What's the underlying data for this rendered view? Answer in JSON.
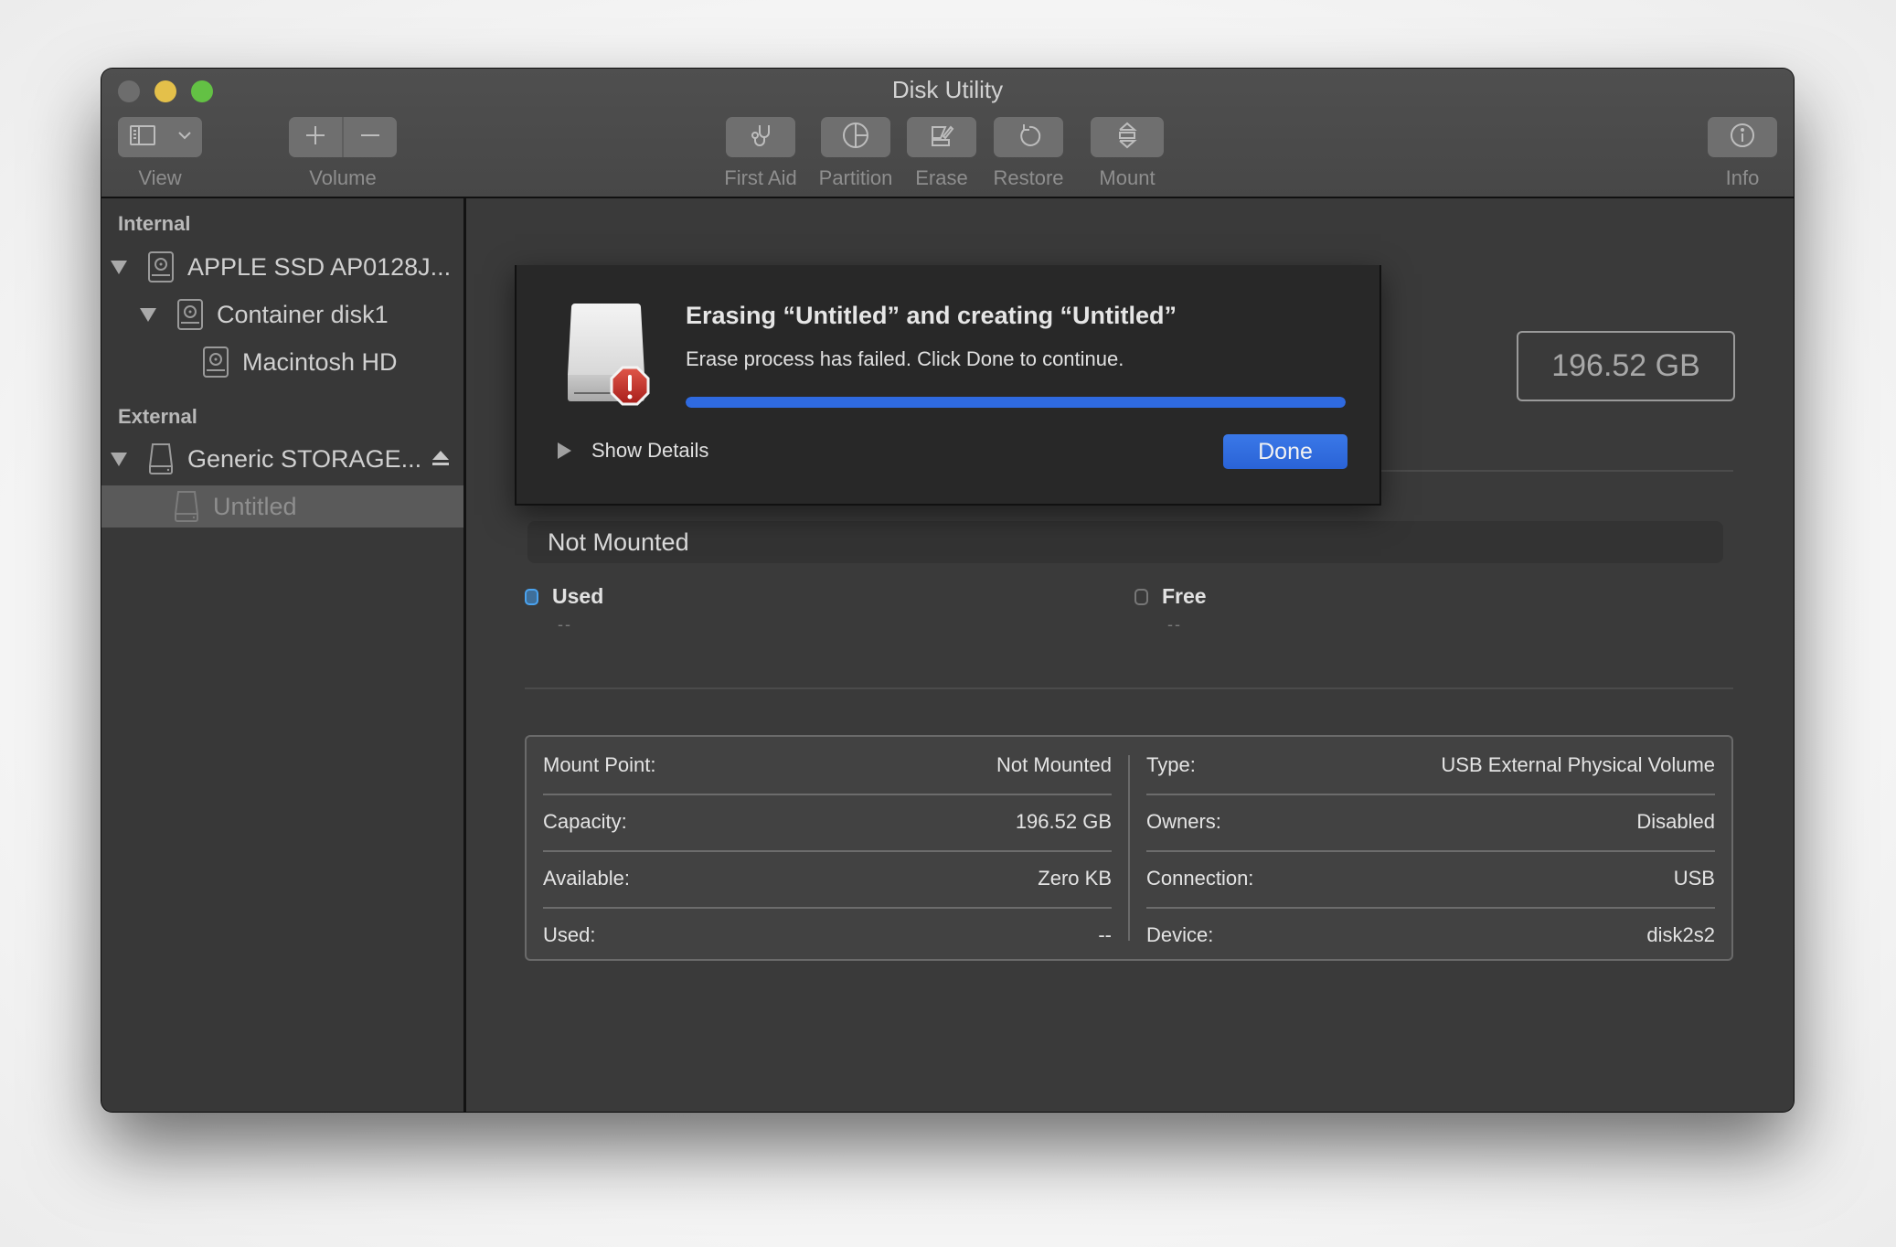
{
  "window": {
    "title": "Disk Utility",
    "traffic_lights": {
      "close": "#6d6d6d",
      "minimize": "#e4c04a",
      "maximize": "#63c144"
    }
  },
  "toolbar": {
    "view": {
      "label": "View",
      "icon": "sidebar-icon"
    },
    "volume": {
      "label": "Volume",
      "add_icon": "plus-icon",
      "remove_icon": "minus-icon"
    },
    "actions": [
      {
        "label": "First Aid",
        "icon": "stethoscope-icon"
      },
      {
        "label": "Partition",
        "icon": "pie-chart-icon"
      },
      {
        "label": "Erase",
        "icon": "erase-icon"
      },
      {
        "label": "Restore",
        "icon": "restore-icon"
      },
      {
        "label": "Mount",
        "icon": "mount-icon"
      }
    ],
    "info": {
      "label": "Info",
      "icon": "info-icon"
    }
  },
  "sidebar": {
    "sections": [
      {
        "title": "Internal",
        "items": [
          {
            "label": "APPLE SSD AP0128J...",
            "level": 0,
            "expanded": true,
            "icon": "internal-disk-icon"
          },
          {
            "label": "Container disk1",
            "level": 1,
            "expanded": true,
            "icon": "internal-disk-icon"
          },
          {
            "label": "Macintosh HD",
            "level": 2,
            "icon": "internal-disk-icon"
          }
        ]
      },
      {
        "title": "External",
        "items": [
          {
            "label": "Generic STORAGE...",
            "level": 0,
            "expanded": true,
            "icon": "external-disk-icon",
            "eject": true
          },
          {
            "label": "Untitled",
            "level": 1,
            "selected": true,
            "icon": "external-disk-icon"
          }
        ]
      }
    ]
  },
  "main": {
    "capacity_badge": "196.52 GB",
    "usage_bar_label": "Not Mounted",
    "legend": [
      {
        "label": "Used",
        "value": "--",
        "color": "#3b82c4"
      },
      {
        "label": "Free",
        "value": "--",
        "color": "#3a3a3a"
      }
    ],
    "info_left": [
      {
        "label": "Mount Point:",
        "value": "Not Mounted"
      },
      {
        "label": "Capacity:",
        "value": "196.52 GB"
      },
      {
        "label": "Available:",
        "value": "Zero KB"
      },
      {
        "label": "Used:",
        "value": "--"
      }
    ],
    "info_right": [
      {
        "label": "Type:",
        "value": "USB External Physical Volume"
      },
      {
        "label": "Owners:",
        "value": "Disabled"
      },
      {
        "label": "Connection:",
        "value": "USB"
      },
      {
        "label": "Device:",
        "value": "disk2s2"
      }
    ]
  },
  "sheet": {
    "title": "Erasing “Untitled” and creating “Untitled”",
    "message": "Erase process has failed. Click Done to continue.",
    "progress_percent": 100,
    "progress_color": "#2f6ae0",
    "show_details_label": "Show Details",
    "done_label": "Done",
    "icon": "external-disk-error-icon"
  }
}
